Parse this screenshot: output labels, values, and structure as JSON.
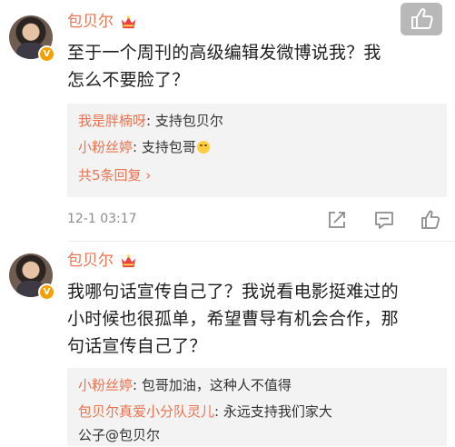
{
  "post1": {
    "username": "包贝尔",
    "text_lines": [
      "至于一个周刊的高级编辑发微博说我？我",
      "怎么不要脸了？"
    ],
    "replies": [
      {
        "name": "我是胖楠呀",
        "text": "支持包贝尔"
      },
      {
        "name": "小粉丝婷",
        "text": "支持包哥"
      }
    ],
    "more_label": "共5条回复 ›",
    "time": "12-1 03:17"
  },
  "post2": {
    "username": "包贝尔",
    "text_lines": [
      "我哪句话宣传自己了？我说看电影挺难过的",
      "小时候也很孤单，希望曹导有机会合作，那",
      "句话宣传自己了？"
    ],
    "replies": [
      {
        "name": "小粉丝婷",
        "text": "包哥加油，这种人不值得"
      },
      {
        "name": "包贝尔真爱小分队灵儿",
        "text": "永远支持我们家大"
      }
    ],
    "reply2_cont": "公子@包贝尔"
  },
  "icons": {
    "top_like": "thumbs-up-icon",
    "crown": "crown-icon",
    "verified": "verified-badge-icon",
    "share": "share-icon",
    "comment": "comment-icon",
    "like": "like-icon"
  },
  "colors": {
    "username": "#eb7350",
    "reply_bg": "#f3f3f4",
    "badge": "#f4a000"
  }
}
